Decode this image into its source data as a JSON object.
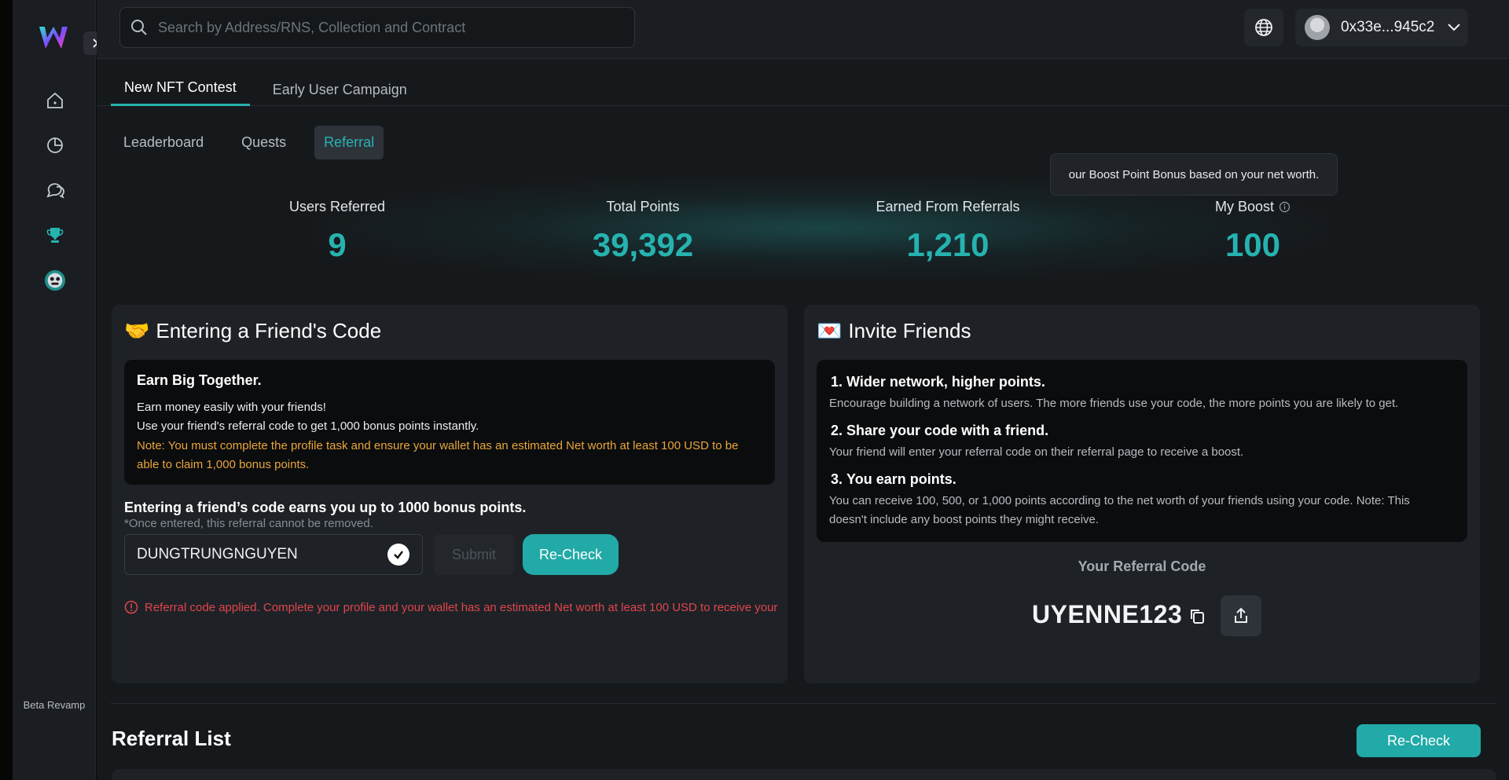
{
  "sidebar": {
    "logo": "W",
    "icons": [
      "home-icon",
      "chart-pie-icon",
      "chat-icon",
      "trophy-icon",
      "robot-avatar-icon"
    ],
    "beta_label": "Beta Revamp"
  },
  "topbar": {
    "search_placeholder": "Search by Address/RNS, Collection and Contract",
    "wallet_address": "0x33e...945c2"
  },
  "tabs": [
    {
      "label": "New NFT Contest",
      "active": true
    },
    {
      "label": "Early User Campaign",
      "active": false
    }
  ],
  "subtabs": [
    {
      "label": "Leaderboard",
      "active": false
    },
    {
      "label": "Quests",
      "active": false
    },
    {
      "label": "Referral",
      "active": true
    }
  ],
  "stats": {
    "users_referred": {
      "label": "Users Referred",
      "value": "9"
    },
    "total_points": {
      "label": "Total Points",
      "value": "39,392"
    },
    "earned_from_referrals": {
      "label": "Earned From Referrals",
      "value": "1,210"
    },
    "my_boost": {
      "label": "My Boost",
      "value": "100"
    }
  },
  "tooltip": "our Boost Point Bonus based on your net worth.",
  "friend_code": {
    "emoji": "🤝",
    "title": "Entering a Friend's Code",
    "box_heading": "Earn Big Together.",
    "line1": "Earn money easily with your friends!",
    "line2": "Use your friend's referral code to get 1,000 bonus points instantly.",
    "note": "Note: You must complete the profile task and ensure your wallet has an estimated Net worth at least 100 USD to be able to claim 1,000 bonus points.",
    "enter_heading": "Entering a friend’s code earns you up to 1000 bonus points.",
    "enter_sub": "*Once entered, this referral cannot be removed.",
    "code_value": "DUNGTRUNGNGUYEN",
    "submit_label": "Submit",
    "recheck_label": "Re-Check",
    "error": "Referral code applied. Complete your profile and your wallet has an estimated Net worth at least 100 USD to receive your"
  },
  "invite": {
    "emoji": "💌",
    "title": "Invite Friends",
    "steps": [
      {
        "num": "1.",
        "heading": "Wider network, higher points.",
        "text": "Encourage building a network of users. The more friends use your code, the more points you are likely to get."
      },
      {
        "num": "2.",
        "heading": "Share your code with a friend.",
        "text": "Your friend will enter your referral code on their referral page to receive a boost."
      },
      {
        "num": "3.",
        "heading": "You earn points.",
        "text": "You can receive 100, 500, or 1,000 points according to the net worth of your friends using your code. Note: This doesn't include any boost points they might receive."
      }
    ],
    "code_label": "Your Referral Code",
    "code": "UYENNE123"
  },
  "referral_list": {
    "title": "Referral List",
    "recheck_label": "Re-Check"
  },
  "colors": {
    "accent": "#26b3b0",
    "note": "#e9a63a",
    "error": "#e0454c"
  }
}
